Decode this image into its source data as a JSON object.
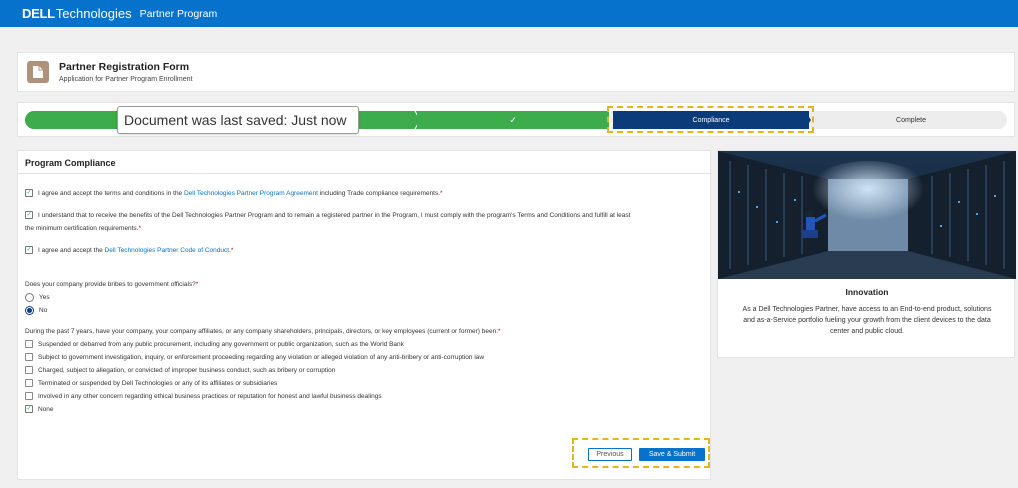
{
  "brand": {
    "name": "DELL",
    "tech": "Technologies",
    "program": "Partner Program"
  },
  "header": {
    "title": "Partner Registration Form",
    "subtitle": "Application for Partner Program Enrollment"
  },
  "tooltip": {
    "text": "Document was last saved: Just now"
  },
  "steps": [
    {
      "label": "",
      "state": "done"
    },
    {
      "label": "",
      "state": "done"
    },
    {
      "label": "Compliance",
      "state": "active"
    },
    {
      "label": "Complete",
      "state": "pending"
    }
  ],
  "colors": {
    "brand": "#0672cb",
    "done": "#3dac4d",
    "active": "#0b3b79",
    "highlight": "#e8b321"
  },
  "form": {
    "title": "Program Compliance",
    "agreement1": {
      "pre": "I agree and accept the terms and conditions in the ",
      "link": "Dell Technologies Partner Program Agreement",
      "post": " including Trade compliance requirements.",
      "req": "*"
    },
    "agreement2": {
      "line1": "I understand that to receive the benefits of the Dell Technologies Partner Program and to remain a registered partner in the Program, I must comply with the program's Terms and Conditions and fulfill at least",
      "line2": "the minimum certification requirements.",
      "req": "*"
    },
    "agreement3": {
      "pre": "I agree and accept the ",
      "link": "Dell Technologies Partner Code of Conduct.",
      "req": "*"
    },
    "bribe_question": "Does your company provide bribes to government officials?",
    "bribe_options": [
      "Yes",
      "No"
    ],
    "history_question": "During the past 7 years, have your company, your company affiliates, or any company shareholders, principals, directors, or key employees (current or former) been:",
    "history_options": [
      "Suspended or debarred from any public procurement, including any government or public organization, such as the World Bank",
      "Subject to government investigation, inquiry, or enforcement proceeding regarding any violation or alleged violation of any anti-bribery or anti-corruption law",
      "Charged, subject to allegation, or convicted of improper business conduct, such as bribery or corruption",
      "Terminated or suspended by Dell Technologies or any of its affiliates or subsidiaries",
      "Involved in any other concern regarding ethical business practices or reputation for honest and lawful business dealings",
      "None"
    ],
    "previous_label": "Previous",
    "save_label": "Save & Submit",
    "check_glyph": "✓"
  },
  "side": {
    "title": "Innovation",
    "text": "As a Dell Technologies Partner, have access to an End-to-end product, solutions and as-a-Service portfolio fueling your growth from the client devices to the data center and public cloud."
  }
}
